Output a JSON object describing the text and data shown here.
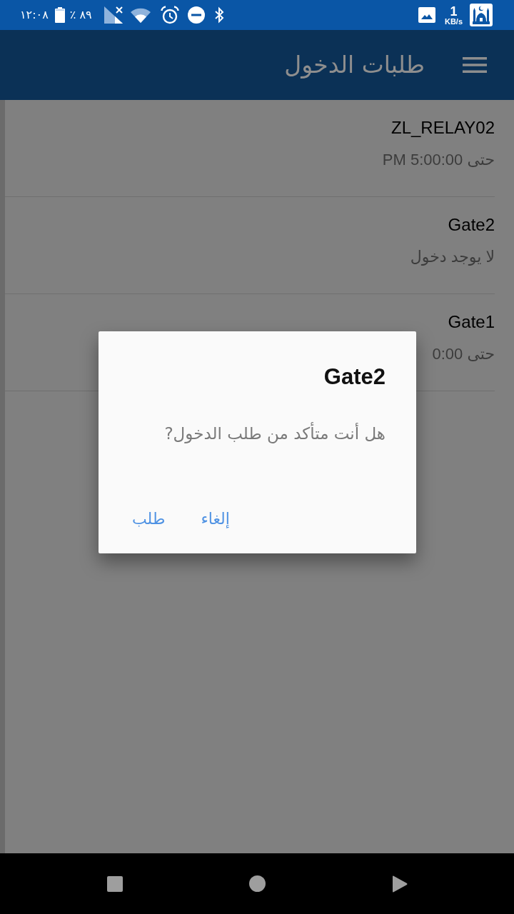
{
  "status_bar": {
    "time": "١٢:٠٨",
    "battery": "٪ ٨٩",
    "speed_value": "1",
    "speed_unit": "KB/s"
  },
  "app_bar": {
    "title": "طلبات الدخول"
  },
  "list": [
    {
      "title": "ZL_RELAY02",
      "subtitle": "حتى 5:00:00 PM"
    },
    {
      "title": "Gate2",
      "subtitle": "لا يوجد دخول"
    },
    {
      "title": "Gate1",
      "subtitle": "حتى 0:00"
    }
  ],
  "dialog": {
    "title": "Gate2",
    "message": "هل أنت متأكد من طلب الدخول?",
    "buttons": [
      "إلغاء",
      "طلب"
    ]
  }
}
